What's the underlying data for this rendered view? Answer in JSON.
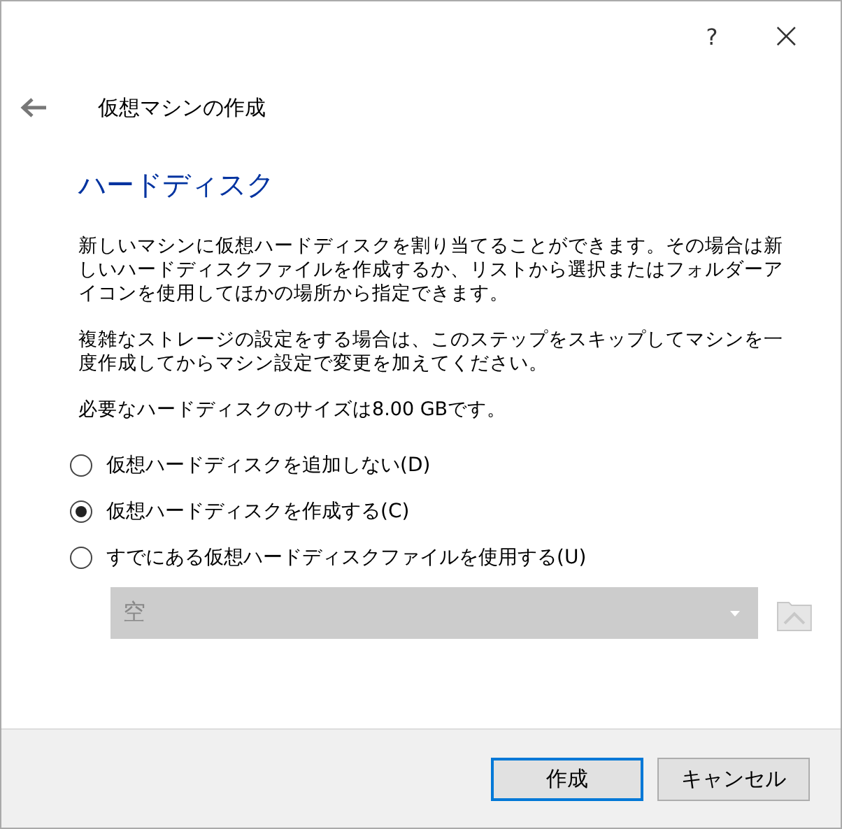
{
  "window": {
    "help": "?",
    "close": "×"
  },
  "header": {
    "title": "仮想マシンの作成"
  },
  "heading": "ハードディスク",
  "paragraphs": [
    "新しいマシンに仮想ハードディスクを割り当てることができます。その場合は新しいハードディスクファイルを作成するか、リストから選択またはフォルダーアイコンを使用してほかの場所から指定できます。",
    "複雑なストレージの設定をする場合は、このステップをスキップしてマシンを一度作成してからマシン設定で変更を加えてください。",
    "必要なハードディスクのサイズは8.00 GBです。"
  ],
  "options": [
    {
      "label": "仮想ハードディスクを追加しない(D)",
      "selected": false
    },
    {
      "label": "仮想ハードディスクを作成する(C)",
      "selected": true
    },
    {
      "label": "すでにある仮想ハードディスクファイルを使用する(U)",
      "selected": false
    }
  ],
  "file_combo": {
    "value": "空",
    "disabled": true
  },
  "buttons": [
    {
      "label": "作成",
      "default": true
    },
    {
      "label": "キャンセル",
      "default": false
    }
  ]
}
